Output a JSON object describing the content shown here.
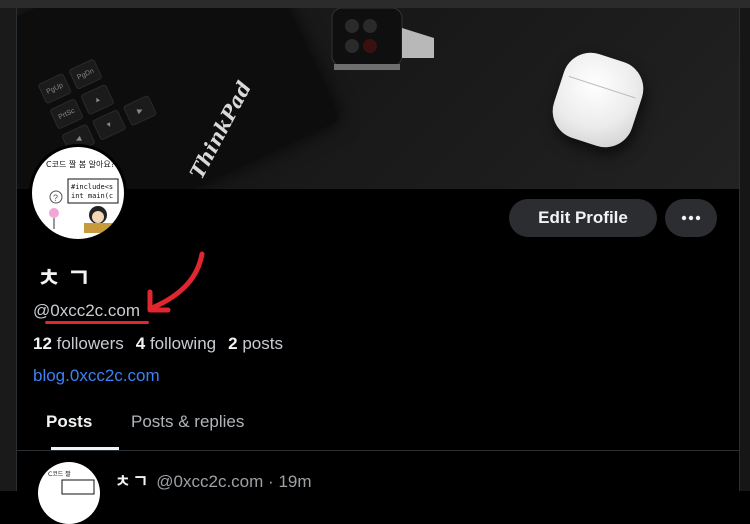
{
  "profile": {
    "display_name": "ㅊㄱ",
    "handle": "@0xcc2c.com",
    "followers_count": "12",
    "followers_label": "followers",
    "following_count": "4",
    "following_label": "following",
    "posts_count": "2",
    "posts_label": "posts",
    "website": "blog.0xcc2c.com",
    "avatar_caption": "C코드 짤 봄 알아요?",
    "avatar_code": "#include<s\nint main(c"
  },
  "actions": {
    "edit_profile_label": "Edit Profile",
    "more_icon": "more-horizontal-icon"
  },
  "banner": {
    "laptop_brand": "ThinkPad",
    "keys": [
      "PgUp",
      "PgDn",
      "PrtSc",
      "Shift"
    ]
  },
  "tabs": [
    {
      "label": "Posts",
      "active": true
    },
    {
      "label": "Posts & replies",
      "active": false
    }
  ],
  "post": {
    "author_name": "ㅊㄱ",
    "author_handle": "@0xcc2c.com",
    "separator": "·",
    "time": "19m"
  },
  "colors": {
    "annotation": "#e0262e",
    "link": "#3b82f6",
    "button_bg": "#2b2d30"
  }
}
